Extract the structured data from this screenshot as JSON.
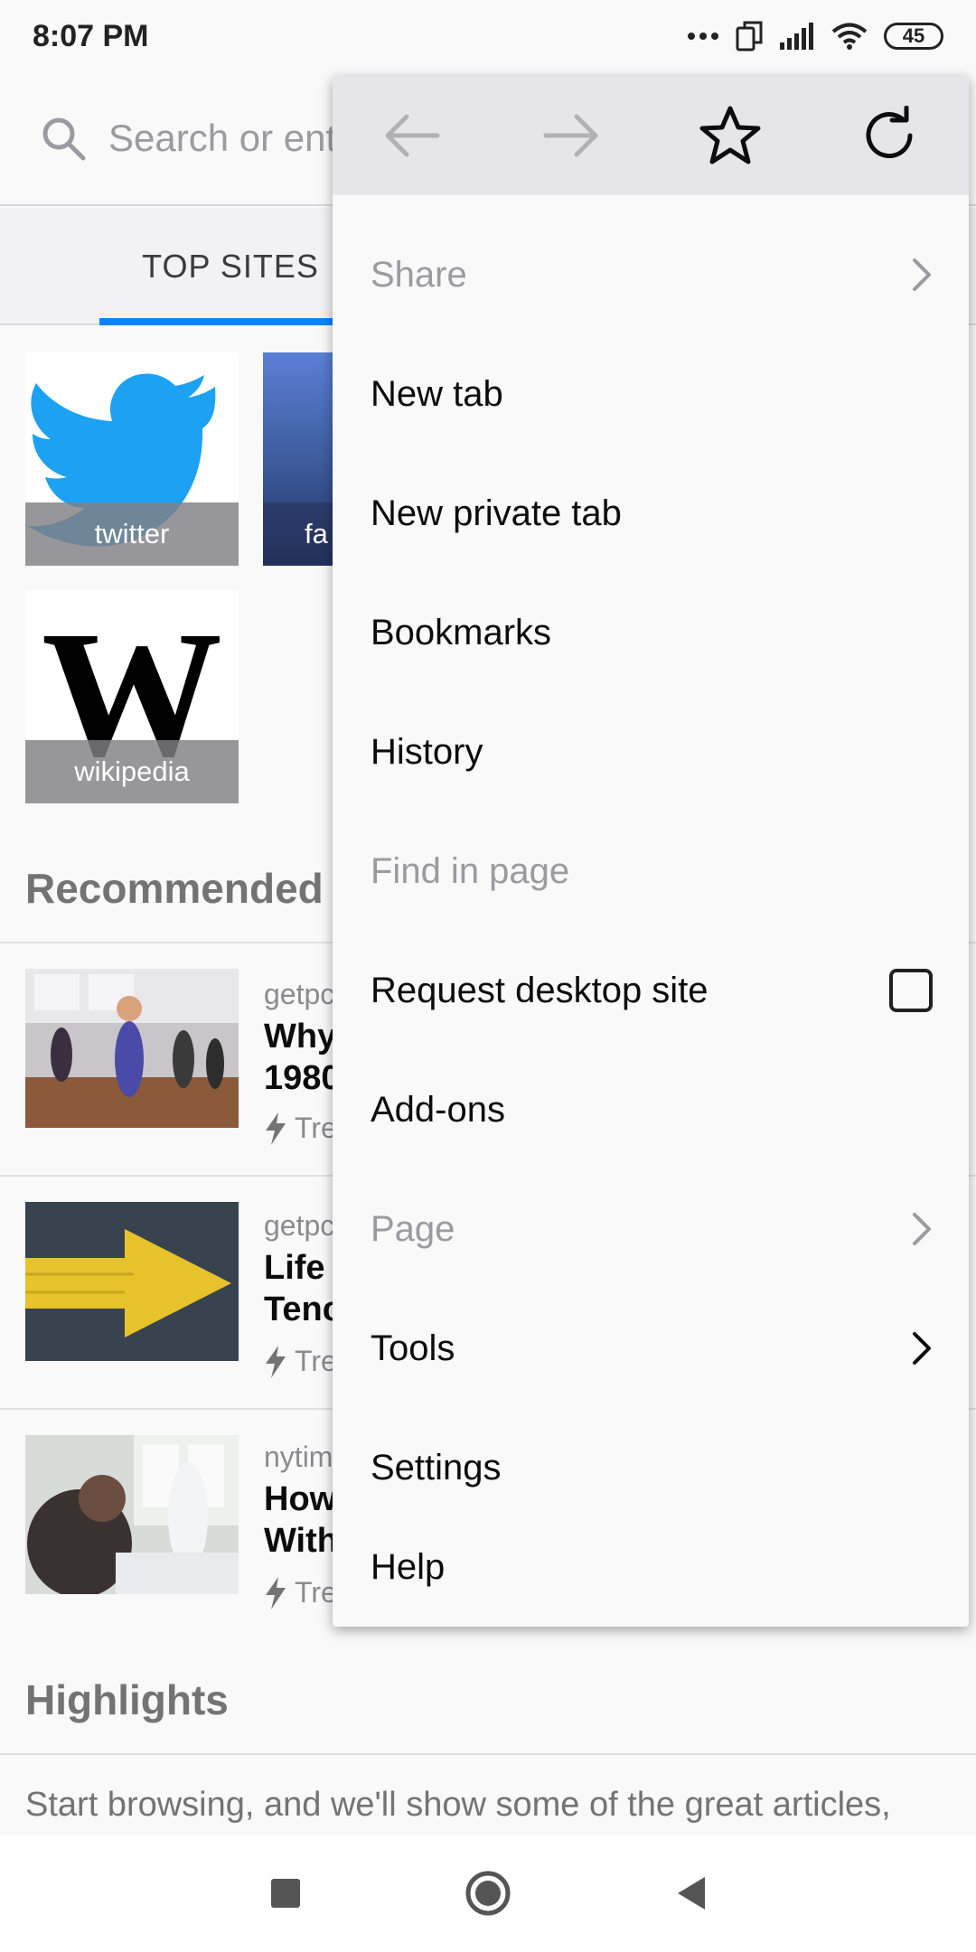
{
  "status_bar": {
    "time": "8:07 PM",
    "battery": "45"
  },
  "url_bar": {
    "placeholder": "Search or ent"
  },
  "tabs": {
    "top_sites": "TOP SITES"
  },
  "top_sites": [
    {
      "label": "twitter",
      "icon": "twitter-bird-logo"
    },
    {
      "label": "fa",
      "icon": "facebook-logo"
    },
    {
      "label": "wikipedia",
      "icon": "wikipedia-w-logo"
    }
  ],
  "recommended": {
    "title": "Recommended",
    "stories": [
      {
        "domain": "getpc",
        "title_line1": "Why",
        "title_line2": "1980",
        "trend": "Tre"
      },
      {
        "domain": "getpc",
        "title_line1": "Life",
        "title_line2": "Tenc",
        "trend": "Tre"
      },
      {
        "domain": "nytim",
        "title_line1": "How",
        "title_line2": "With",
        "trend": "Tre"
      }
    ]
  },
  "highlights": {
    "title": "Highlights",
    "empty_text": "Start browsing, and we'll show some of the great articles,"
  },
  "menu": {
    "toolbar": [
      "back-arrow-icon",
      "forward-arrow-icon",
      "star-icon",
      "reload-icon"
    ],
    "items": [
      {
        "label": "Share",
        "enabled": false,
        "trailing": "chevron"
      },
      {
        "label": "New tab",
        "enabled": true
      },
      {
        "label": "New private tab",
        "enabled": true
      },
      {
        "label": "Bookmarks",
        "enabled": true
      },
      {
        "label": "History",
        "enabled": true
      },
      {
        "label": "Find in page",
        "enabled": false
      },
      {
        "label": "Request desktop site",
        "enabled": true,
        "trailing": "checkbox",
        "checked": false
      },
      {
        "label": "Add-ons",
        "enabled": true
      },
      {
        "label": "Page",
        "enabled": false,
        "trailing": "chevron"
      },
      {
        "label": "Tools",
        "enabled": true,
        "trailing": "chevron"
      },
      {
        "label": "Settings",
        "enabled": true
      },
      {
        "label": "Help",
        "enabled": true
      }
    ]
  },
  "colors": {
    "accent": "#0a84ff",
    "twitter_blue": "#1da1f2",
    "facebook_blue": "#3b5998"
  }
}
